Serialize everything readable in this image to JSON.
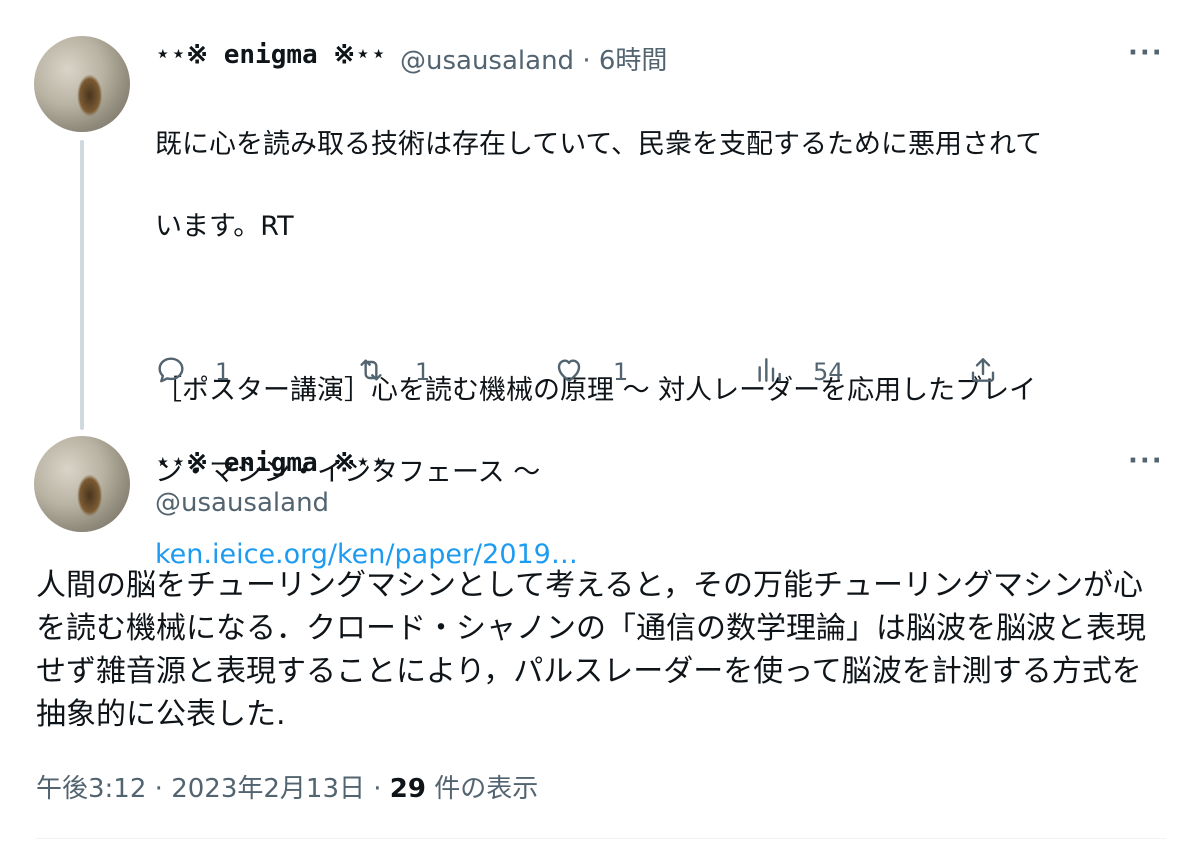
{
  "tweet1": {
    "display_name": "⋆⋆※ enigma ※⋆⋆",
    "handle": "@usausaland",
    "separator": "·",
    "time": "6時間",
    "body_line1": "既に心を読み取る技術は存在していて、民衆を支配するために悪用されて",
    "body_line2": "います。RT",
    "body_line3": "［ポスター講演］心を読む機械の原理 〜 対人レーダーを応用したブレイ",
    "body_line4": "ン・マシン・インタフェース 〜",
    "link": "ken.ieice.org/ken/paper/2019…",
    "more": "···",
    "actions": {
      "reply_count": "1",
      "retweet_count": "1",
      "like_count": "1",
      "views_count": "54"
    }
  },
  "tweet2": {
    "display_name": "⋆⋆※ enigma ※⋆⋆",
    "handle": "@usausaland",
    "more": "···",
    "body": "人間の脳をチューリングマシンとして考えると，その万能チューリングマシンが心を読む機械になる．クロード・シャノンの「通信の数学理論」は脳波を脳波と表現せず雑音源と表現することにより，パルスレーダーを使って脳波を計測する方式を抽象的に公表した.",
    "time": "午後3:12",
    "separator": "·",
    "date": "2023年2月13日",
    "views_number": "29",
    "views_label": "件の表示"
  },
  "icons": [
    "reply-icon",
    "retweet-icon",
    "like-icon",
    "views-icon",
    "share-icon"
  ],
  "colors": {
    "link": "#1d9bf0",
    "muted": "#536471",
    "text": "#0f1419"
  }
}
